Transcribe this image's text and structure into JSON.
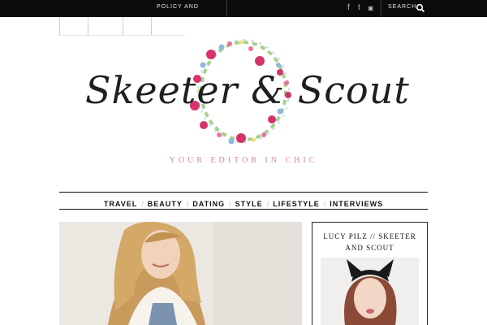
{
  "topbar": {
    "policy_label": "POLICY AND",
    "social": [
      {
        "icon": "facebook-icon",
        "glyph": "f"
      },
      {
        "icon": "twitter-icon",
        "glyph": "t"
      },
      {
        "icon": "instagram-icon",
        "glyph": "◙"
      }
    ],
    "search_label": "SEARCH",
    "search_icon": "search-icon"
  },
  "logo": {
    "title": "Skeeter & Scout",
    "tagline": "YOUR EDITOR IN CHIC"
  },
  "nav": {
    "items": [
      "TRAVEL",
      "BEAUTY",
      "DATING",
      "STYLE",
      "LIFESTYLE",
      "INTERVIEWS"
    ]
  },
  "sidebar": {
    "title_line1": "LUCY PILZ // SKEETER",
    "title_line2": "AND SCOUT"
  },
  "colors": {
    "topbar": "#0b0b0b",
    "tagline": "#d78a92",
    "wreath_pink": "#d6336c",
    "wreath_blue": "#8fb8e0",
    "wreath_green": "#7fbf6a"
  }
}
